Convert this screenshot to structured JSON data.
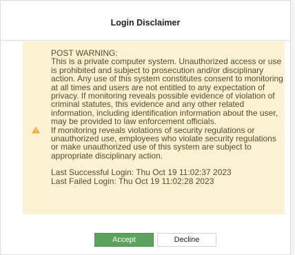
{
  "dialog": {
    "title": "Login Disclaimer"
  },
  "warning": {
    "icon": "warning-triangle-icon",
    "accent_color": "#f0a51c",
    "background_color": "#fdf1d4",
    "heading": "POST WARNING:",
    "body": "This is a private computer system. Unauthorized access or use is prohibited and subject to prosecution and/or disciplinary action. Any use of this system constitutes consent to monitoring at all times and users are not entitled to any expectation of privacy. If monitoring reveals possible evidence of violation of criminal statutes, this evidence and any other related information, including identification information about the user, may be provided to law enforcement officials.",
    "body2": "If monitoring reveals violations of security regulations or unauthorized use, employees who violate security regulations or make unauthorized use of this system are subject to appropriate disciplinary action.",
    "last_successful_login": "Last Successful Login: Thu Oct 19 11:02:37 2023",
    "last_failed_login": "Last Failed Login: Thu Oct 19 11:02:28 2023"
  },
  "buttons": {
    "accept_label": "Accept",
    "accept_color": "#5da35e",
    "decline_label": "Decline"
  }
}
